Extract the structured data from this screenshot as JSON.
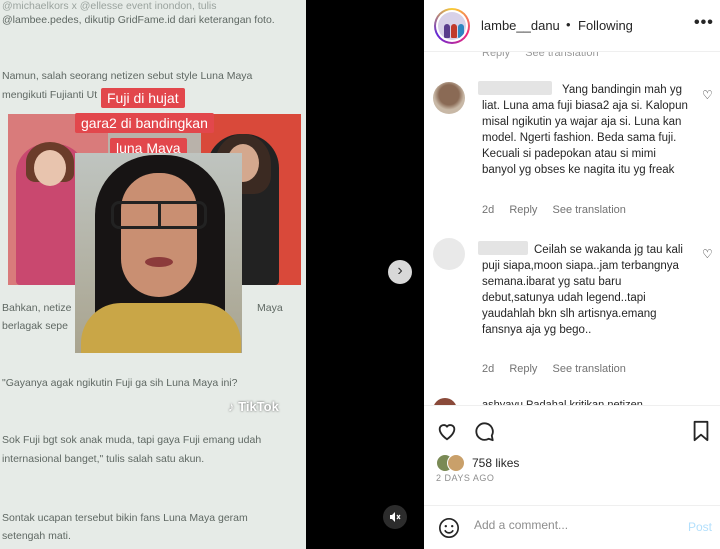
{
  "video": {
    "article_lines": [
      "@lambee.pedes, dikutip GridFame.id dari keterangan foto.",
      "Namun, salah seorang netizen sebut style Luna Maya",
      "mengikuti Fujianti Ut",
      "Bahkan, netize",
      "Maya",
      "berlagak sepe",
      "\"Gayanya agak ngikutin Fuji ga sih Luna Maya ini?",
      "Sok Fuji bgt sok anak muda, tapi gaya Fuji emang udah",
      "internasional banget,\" tulis salah satu akun.",
      "Sontak ucapan tersebut bikin fans Luna Maya geram",
      "setengah mati."
    ],
    "caption_lines": [
      "Fuji di hujat",
      "gara2 di bandingkan",
      "luna Maya"
    ],
    "watermark": "TikTok",
    "watermark_icon": "tiktok-note-icon",
    "next_icon": "chevron-right-icon",
    "mute_icon": "speaker-muted-icon"
  },
  "post": {
    "username": "lambe__danu",
    "separator": "•",
    "follow_status": "Following",
    "more_label": "•••"
  },
  "comments": [
    {
      "text": "Yang bandingin mah yg liat. Luna ama fuji biasa2 aja si. Kalopun misal ngikutin ya wajar aja si. Luna kan model. Ngerti fashion. Beda sama fuji. Kecuali si padepokan atau si mimi banyol yg obses ke nagita itu yg freak",
      "age": "2d",
      "reply": "Reply",
      "translate": "See translation"
    },
    {
      "text": "Ceilah se wakanda jg tau kali puji siapa,moon siapa..jam terbangnya semana.ibarat yg satu baru debut,satunya udah legend..tapi yaudahlah bkn slh artisnya.emang fansnya aja yg bego..",
      "age": "2d",
      "reply": "Reply",
      "translate": "See translation"
    }
  ],
  "partial_top": {
    "reply": "Reply",
    "translate": "See translation"
  },
  "partial_bottom": "ashyayu Padahal kritikan netizen",
  "actions": {
    "likes": "758 likes",
    "date": "2 DAYS AGO",
    "comment_placeholder": "Add a comment...",
    "post_label": "Post"
  },
  "colors": {
    "caption_bg": "#e2474c",
    "link_disabled": "#b2dffc",
    "meta_gray": "#737373"
  }
}
